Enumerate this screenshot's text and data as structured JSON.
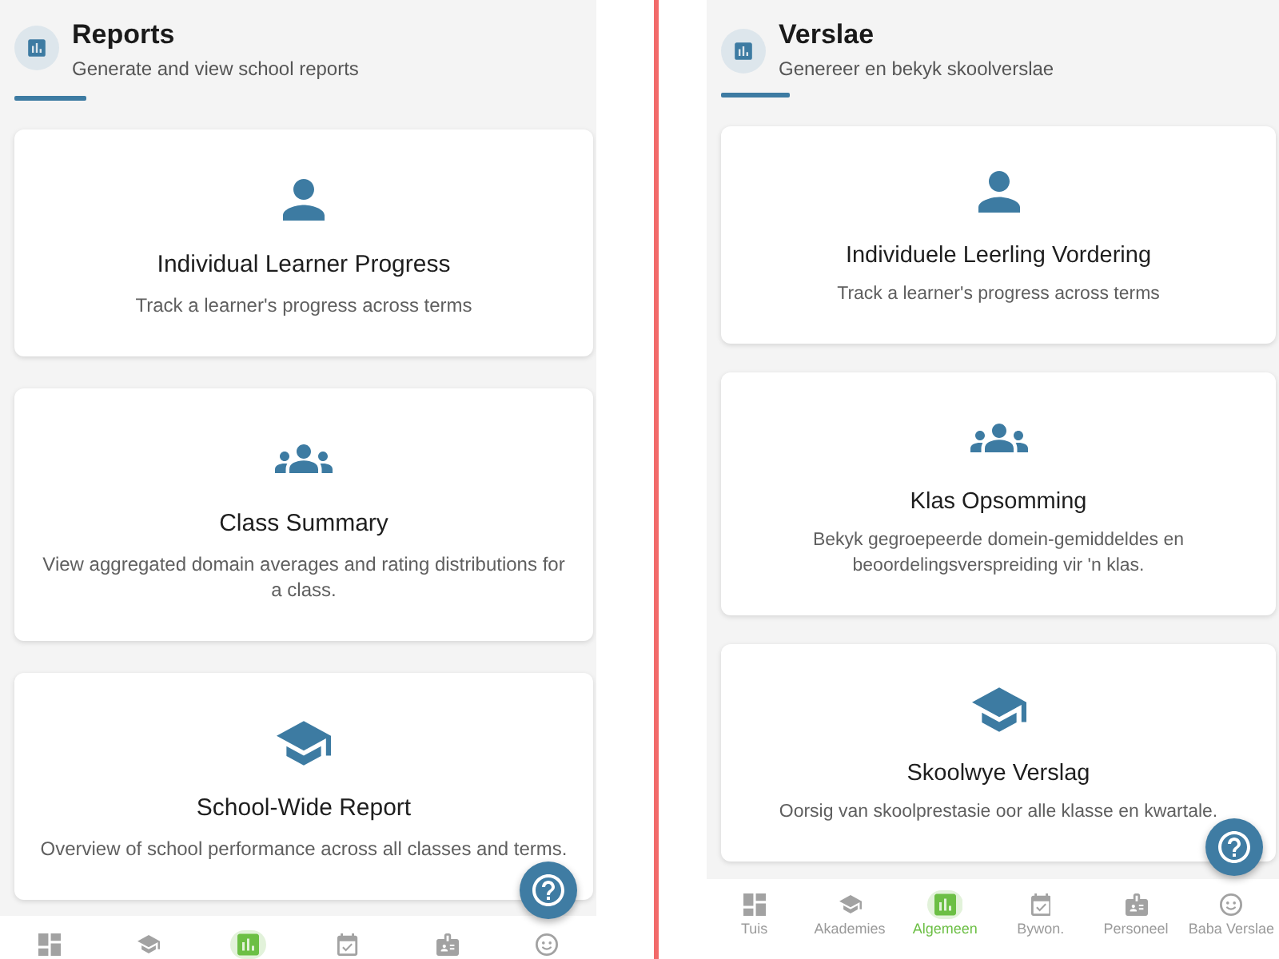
{
  "screens": [
    {
      "header": {
        "title": "Reports",
        "subtitle": "Generate and view school reports"
      },
      "cards": [
        {
          "kind": "learner",
          "title": "Individual Learner Progress",
          "description": "Track a learner's progress across terms"
        },
        {
          "kind": "class",
          "title": "Class Summary",
          "description": "View aggregated domain averages and rating distributions for a class."
        },
        {
          "kind": "school",
          "title": "School-Wide Report",
          "description": "Overview of school performance across all classes and terms."
        }
      ],
      "nav": [
        {
          "kind": "home",
          "selected": false
        },
        {
          "kind": "academics",
          "selected": false
        },
        {
          "kind": "reports",
          "selected": true
        },
        {
          "kind": "attendance",
          "selected": false
        },
        {
          "kind": "staff",
          "selected": false
        },
        {
          "kind": "baby",
          "selected": false
        }
      ]
    },
    {
      "header": {
        "title": "Verslae",
        "subtitle": "Genereer en bekyk skoolverslae"
      },
      "cards": [
        {
          "kind": "learner",
          "title": "Individuele Leerling Vordering",
          "description": "Track a learner's progress across terms"
        },
        {
          "kind": "class",
          "title": "Klas Opsomming",
          "description": "Bekyk gegroepeerde domein-gemiddeldes en beoordelingsverspreiding vir 'n klas."
        },
        {
          "kind": "school",
          "title": "Skoolwye Verslag",
          "description": "Oorsig van skoolprestasie oor alle klasse en kwartale."
        }
      ],
      "nav": [
        {
          "kind": "home",
          "label": "Tuis",
          "selected": false
        },
        {
          "kind": "academics",
          "label": "Akademies",
          "selected": false
        },
        {
          "kind": "reports",
          "label": "Algemeen",
          "selected": true
        },
        {
          "kind": "attendance",
          "label": "Bywon.",
          "selected": false
        },
        {
          "kind": "staff",
          "label": "Personeel",
          "selected": false
        },
        {
          "kind": "baby",
          "label": "Baba Verslae",
          "selected": false
        }
      ]
    }
  ]
}
